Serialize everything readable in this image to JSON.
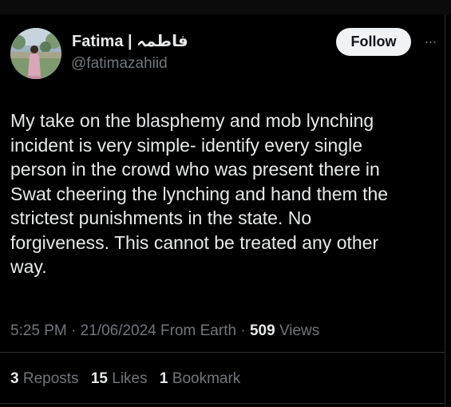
{
  "author": {
    "display_name": "Fatima | فاطمہ",
    "handle": "@fatimazahiid",
    "avatar_icon": "profile-photo"
  },
  "actions": {
    "follow_label": "Follow",
    "more_icon": "more-horizontal-icon",
    "more_glyph": "···"
  },
  "tweet": {
    "text": "My take on the blasphemy and mob lynching\nincident is very simple- identify every single\nperson in the crowd who was present there in\nSwat cheering the lynching and hand them the\nstrictest punishments in the state. No\nforgiveness. This cannot be treated any other\nway."
  },
  "meta": {
    "time": "5:25 PM",
    "date": "21/06/2024",
    "source": "From Earth",
    "views_count": "509",
    "views_label": "Views",
    "separator": "·"
  },
  "stats": {
    "reposts_count": "3",
    "reposts_label": "Reposts",
    "likes_count": "15",
    "likes_label": "Likes",
    "bookmarks_count": "1",
    "bookmarks_label": "Bookmark"
  },
  "colors": {
    "background": "#000000",
    "text_primary": "#e7e9ea",
    "text_secondary": "#71767b",
    "button_bg": "#eff3f4",
    "divider": "#2f3336"
  }
}
